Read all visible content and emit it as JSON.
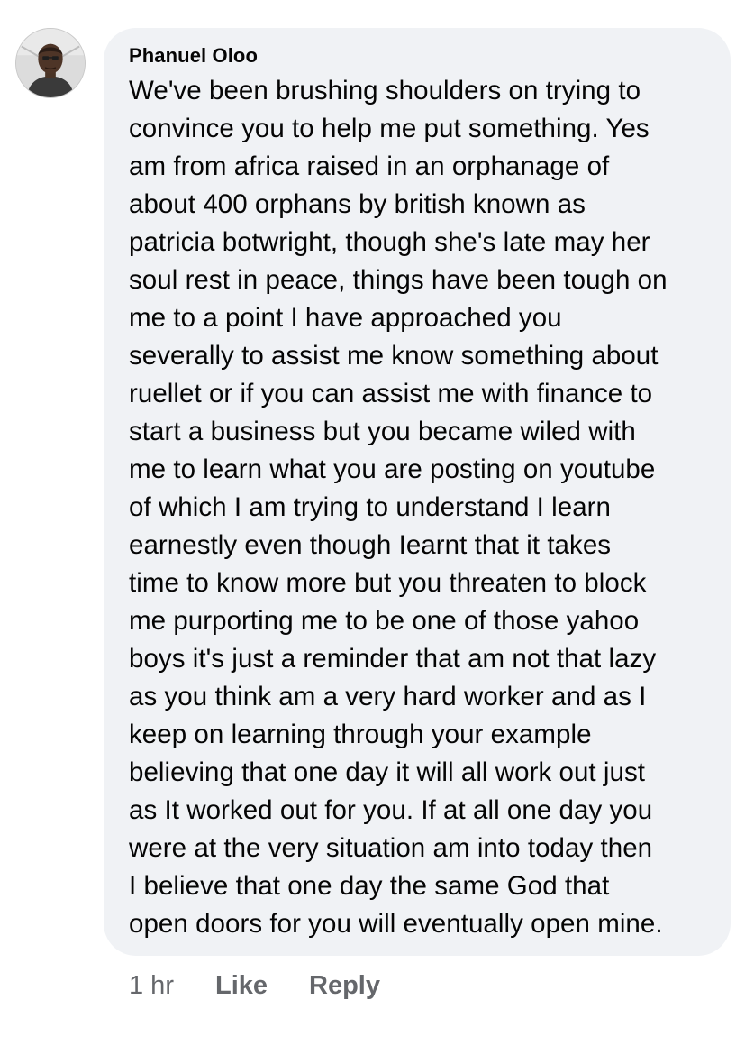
{
  "comment": {
    "author": "Phanuel Oloo",
    "avatar_icon": "user-avatar-photo",
    "text": "We've been brushing shoulders on trying to\nconvince you to help me put something. Yes\nam from africa raised in an orphanage of\nabout 400 orphans by british known as\npatricia botwright, though she's late may her\nsoul rest in peace, things have been tough on\nme to a point I have approached you\nseverally to assist me know something about\nruellet or if you can assist me with finance to\nstart a business but you became wiled with\nme to learn what you are posting on youtube\nof which I am trying to understand I learn\nearnestly even though Iearnt that it takes\ntime to know more but you threaten to block\nme purporting me to be one of those yahoo\nboys it's just a reminder that am not that lazy\nas you think am a very hard worker and as I\nkeep on learning through your example\nbelieving that one day it will all work out just\nas It worked out for you. If at all one day you\nwere at the very situation am into today then\nI believe that one day the same God that\nopen doors for you will eventually open mine.",
    "timestamp": "1 hr",
    "like_label": "Like",
    "reply_label": "Reply"
  },
  "colors": {
    "bubble_background": "#f0f2f5",
    "text": "#050505",
    "secondary_text": "#65676b"
  }
}
